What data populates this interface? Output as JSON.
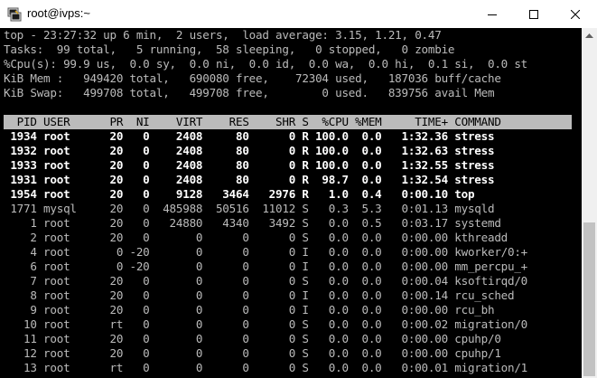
{
  "window": {
    "title": "root@ivps:~",
    "icon": "putty-terminal-icon",
    "controls": [
      "minimize-icon",
      "maximize-icon",
      "close-icon"
    ]
  },
  "terminal": {
    "summary": [
      "top - 23:27:32 up 6 min,  2 users,  load average: 3.15, 1.21, 0.47",
      "Tasks:  99 total,   5 running,  58 sleeping,   0 stopped,   0 zombie",
      "%Cpu(s): 99.9 us,  0.0 sy,  0.0 ni,  0.0 id,  0.0 wa,  0.0 hi,  0.1 si,  0.0 st",
      "KiB Mem :   949420 total,   690080 free,    72304 used,   187036 buff/cache",
      "KiB Swap:   499708 total,   499708 free,        0 used.   839756 avail Mem"
    ],
    "blank": "",
    "header": "  PID USER      PR  NI    VIRT    RES    SHR S  %CPU %MEM     TIME+ COMMAND",
    "processes": [
      {
        "text": " 1934 root      20   0    2408     80      0 R 100.0  0.0   1:32.36 stress",
        "highlight": true
      },
      {
        "text": " 1932 root      20   0    2408     80      0 R 100.0  0.0   1:32.63 stress",
        "highlight": true
      },
      {
        "text": " 1933 root      20   0    2408     80      0 R 100.0  0.0   1:32.55 stress",
        "highlight": true
      },
      {
        "text": " 1931 root      20   0    2408     80      0 R  98.7  0.0   1:32.54 stress",
        "highlight": true
      },
      {
        "text": " 1954 root      20   0    9128   3464   2976 R   1.0  0.4   0:00.10 top",
        "highlight": true
      },
      {
        "text": " 1771 mysql     20   0  485988  50516  11012 S   0.3  5.3   0:01.13 mysqld",
        "highlight": false
      },
      {
        "text": "    1 root      20   0   24880   4340   3492 S   0.0  0.5   0:03.17 systemd",
        "highlight": false
      },
      {
        "text": "    2 root      20   0       0      0      0 S   0.0  0.0   0:00.00 kthreadd",
        "highlight": false
      },
      {
        "text": "    4 root       0 -20       0      0      0 I   0.0  0.0   0:00.00 kworker/0:+",
        "highlight": false
      },
      {
        "text": "    6 root       0 -20       0      0      0 I   0.0  0.0   0:00.00 mm_percpu_+",
        "highlight": false
      },
      {
        "text": "    7 root      20   0       0      0      0 S   0.0  0.0   0:00.04 ksoftirqd/0",
        "highlight": false
      },
      {
        "text": "    8 root      20   0       0      0      0 I   0.0  0.0   0:00.14 rcu_sched",
        "highlight": false
      },
      {
        "text": "    9 root      20   0       0      0      0 I   0.0  0.0   0:00.00 rcu_bh",
        "highlight": false
      },
      {
        "text": "   10 root      rt   0       0      0      0 S   0.0  0.0   0:00.02 migration/0",
        "highlight": false
      },
      {
        "text": "   11 root      20   0       0      0      0 S   0.0  0.0   0:00.00 cpuhp/0",
        "highlight": false
      },
      {
        "text": "   12 root      20   0       0      0      0 S   0.0  0.0   0:00.00 cpuhp/1",
        "highlight": false
      },
      {
        "text": "   13 root      rt   0       0      0      0 S   0.0  0.0   0:00.01 migration/1",
        "highlight": false
      }
    ]
  },
  "colors": {
    "terminal_bg": "#000000",
    "terminal_fg": "#bbbbbb",
    "bold_fg": "#ffffff",
    "header_bg": "#bbbbbb",
    "header_fg": "#000000"
  }
}
